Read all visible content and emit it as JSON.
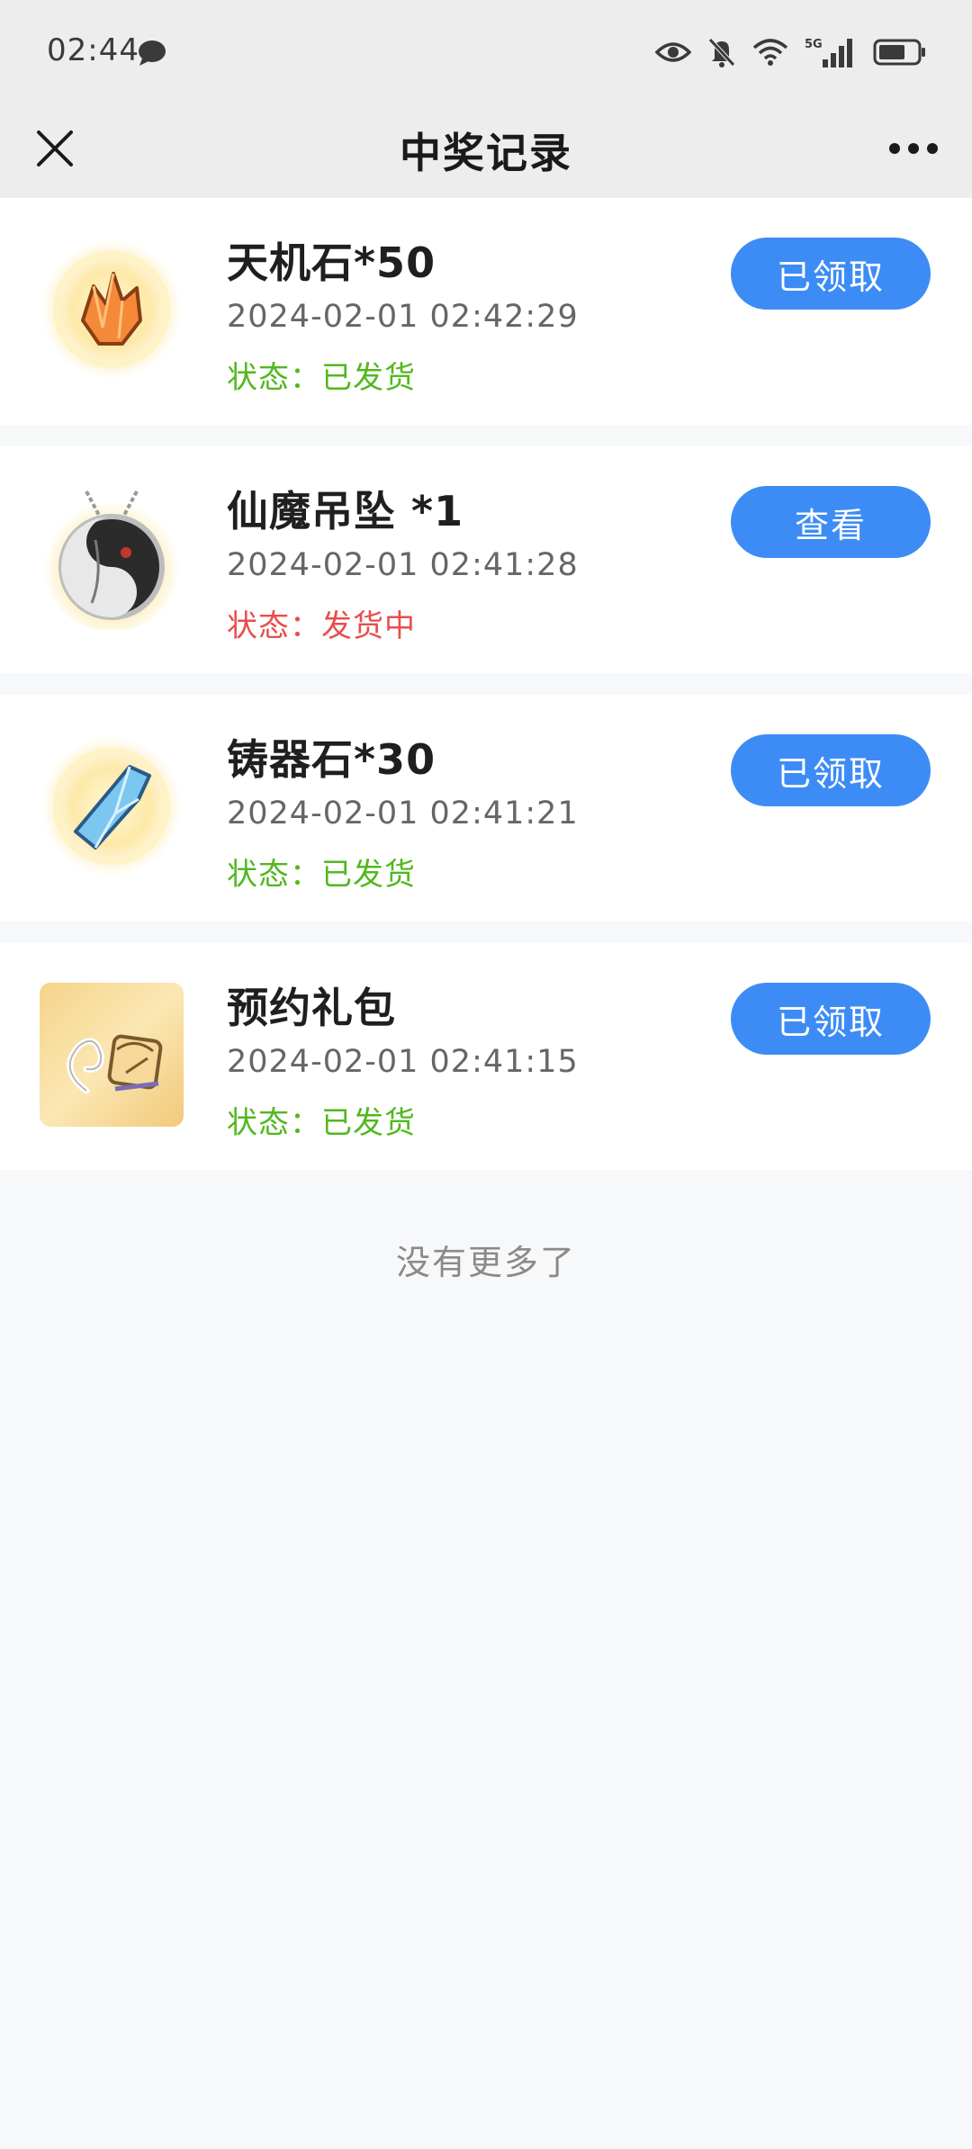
{
  "status_bar": {
    "time": "02:44",
    "network": "5G"
  },
  "header": {
    "title": "中奖记录"
  },
  "records": [
    {
      "name": "天机石*50",
      "time": "2024-02-01 02:42:29",
      "status_label": "状态：",
      "status_value": "已发货",
      "status_color": "#52b81f",
      "button_label": "已领取",
      "icon": "orange-crystal-icon"
    },
    {
      "name": "仙魔吊坠 *1",
      "time": "2024-02-01 02:41:28",
      "status_label": "状态：",
      "status_value": "发货中",
      "status_color": "#e94d4d",
      "button_label": "查看",
      "icon": "yin-yang-pendant-icon"
    },
    {
      "name": "铸器石*30",
      "time": "2024-02-01 02:41:21",
      "status_label": "状态：",
      "status_value": "已发货",
      "status_color": "#52b81f",
      "button_label": "已领取",
      "icon": "blue-crystal-icon"
    },
    {
      "name": "预约礼包",
      "time": "2024-02-01 02:41:15",
      "status_label": "状态：",
      "status_value": "已发货",
      "status_color": "#52b81f",
      "button_label": "已领取",
      "icon": "gift-pack-icon"
    }
  ],
  "footer": {
    "no_more": "没有更多了"
  },
  "colors": {
    "accent_button": "#3d8cf5",
    "status_ok": "#52b81f",
    "status_pending": "#e94d4d",
    "header_bg": "#ededed",
    "page_bg": "#f7f8fa"
  }
}
